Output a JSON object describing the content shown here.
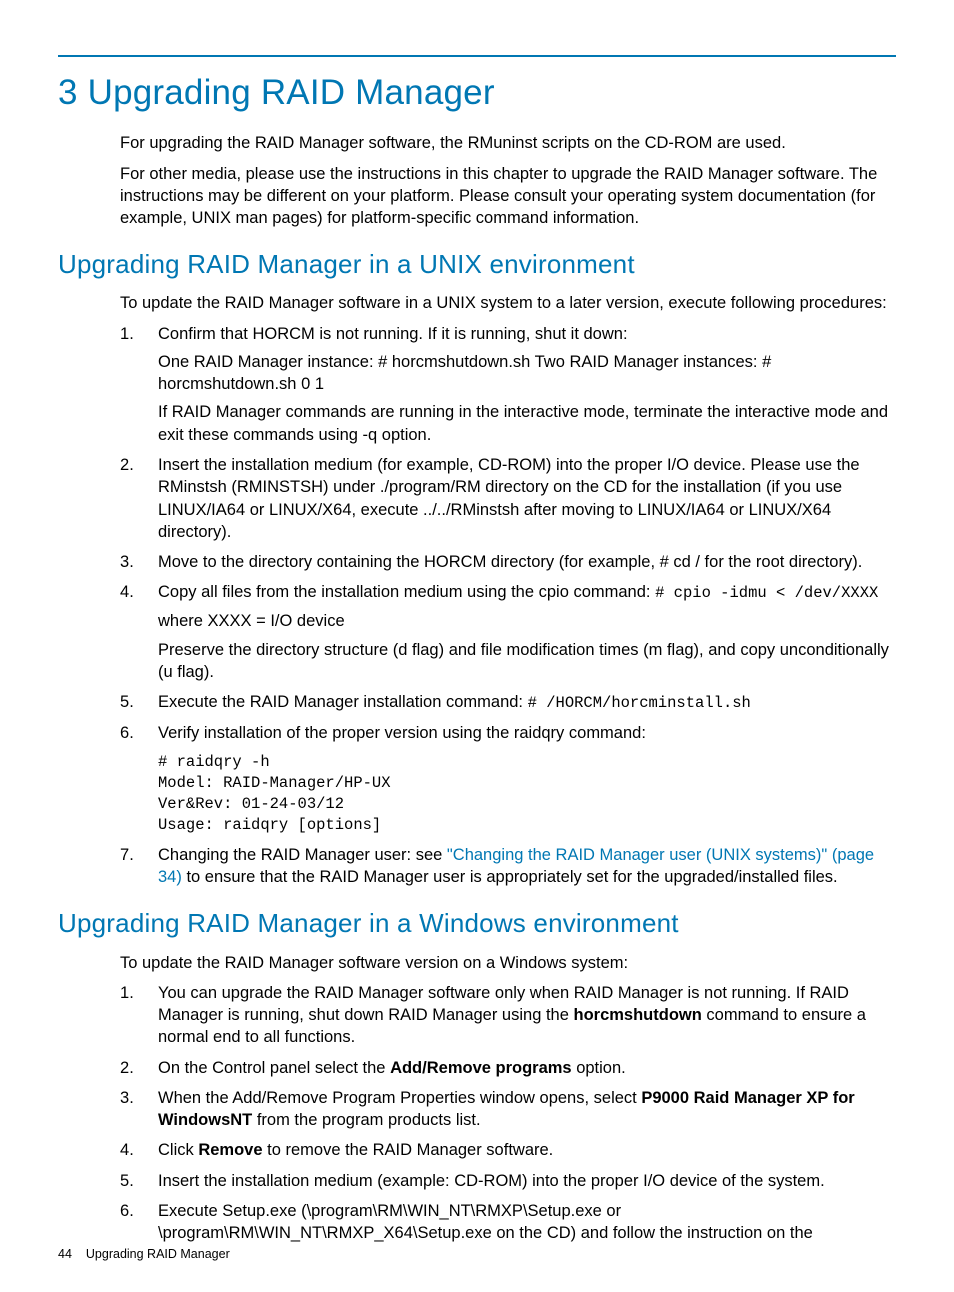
{
  "title": "3 Upgrading RAID Manager",
  "intro1": "For upgrading the RAID Manager software, the RMuninst scripts on the CD-ROM are used.",
  "intro2": "For other media, please use the instructions in this chapter to upgrade the RAID Manager software. The instructions may be different on your platform. Please consult your operating system documentation (for example, UNIX man pages) for platform-specific command information.",
  "sec1": {
    "heading": "Upgrading RAID Manager in a UNIX environment",
    "intro": "To update the RAID Manager software in a UNIX system to a later version, execute following procedures:",
    "li1": {
      "a": "Confirm that HORCM is not running. If it is running, shut it down:",
      "b": "One RAID Manager instance: # horcmshutdown.sh Two RAID Manager instances: # horcmshutdown.sh 0 1",
      "c": "If RAID Manager commands are running in the interactive mode, terminate the interactive mode and exit these commands using -q option."
    },
    "li2": "Insert the installation medium (for example, CD-ROM) into the proper I/O device. Please use the RMinstsh (RMINSTSH) under ./program/RM directory on the CD for the installation (if you use LINUX/IA64 or LINUX/X64, execute ../../RMinstsh after moving to LINUX/IA64 or LINUX/X64 directory).",
    "li3": "Move to the directory containing the HORCM directory (for example, # cd / for the root directory).",
    "li4": {
      "a": "Copy all files from the installation medium using the cpio command: ",
      "code": "# cpio -idmu < /dev/XXXX",
      "b": "where XXXX = I/O device",
      "c": "Preserve the directory structure (d flag) and file modification times (m flag), and copy unconditionally (u flag)."
    },
    "li5": {
      "a": "Execute the RAID Manager installation command: ",
      "code": "# /HORCM/horcminstall.sh"
    },
    "li6": {
      "a": "Verify installation of the proper version using the raidqry command:",
      "code": "# raidqry -h\nModel: RAID-Manager/HP-UX\nVer&Rev: 01-24-03/12\nUsage: raidqry [options]"
    },
    "li7": {
      "a": "Changing the RAID Manager user: see ",
      "link": "\"Changing the RAID Manager user (UNIX systems)\" (page 34)",
      "b": " to ensure that the RAID Manager user is appropriately set for the upgraded/installed files."
    }
  },
  "sec2": {
    "heading": "Upgrading RAID Manager in a Windows environment",
    "intro": "To update the RAID Manager software version on a Windows system:",
    "li1": {
      "a": "You can upgrade the RAID Manager software only when RAID Manager is not running. If RAID Manager is running, shut down RAID Manager using the ",
      "b": "horcmshutdown",
      "c": " command to ensure a normal end to all functions."
    },
    "li2": {
      "a": "On the Control panel select the ",
      "b": "Add/Remove programs",
      "c": " option."
    },
    "li3": {
      "a": "When the Add/Remove Program Properties window opens, select ",
      "b": "P9000 Raid Manager XP for WindowsNT",
      "c": " from the program products list."
    },
    "li4": {
      "a": "Click ",
      "b": "Remove",
      "c": " to remove the RAID Manager software."
    },
    "li5": "Insert the installation medium (example: CD-ROM) into the proper I/O device of the system.",
    "li6": "Execute Setup.exe (\\program\\RM\\WIN_NT\\RMXP\\Setup.exe or \\program\\RM\\WIN_NT\\RMXP_X64\\Setup.exe on the CD) and follow the instruction on the"
  },
  "footer": {
    "page": "44",
    "section": "Upgrading RAID Manager"
  }
}
